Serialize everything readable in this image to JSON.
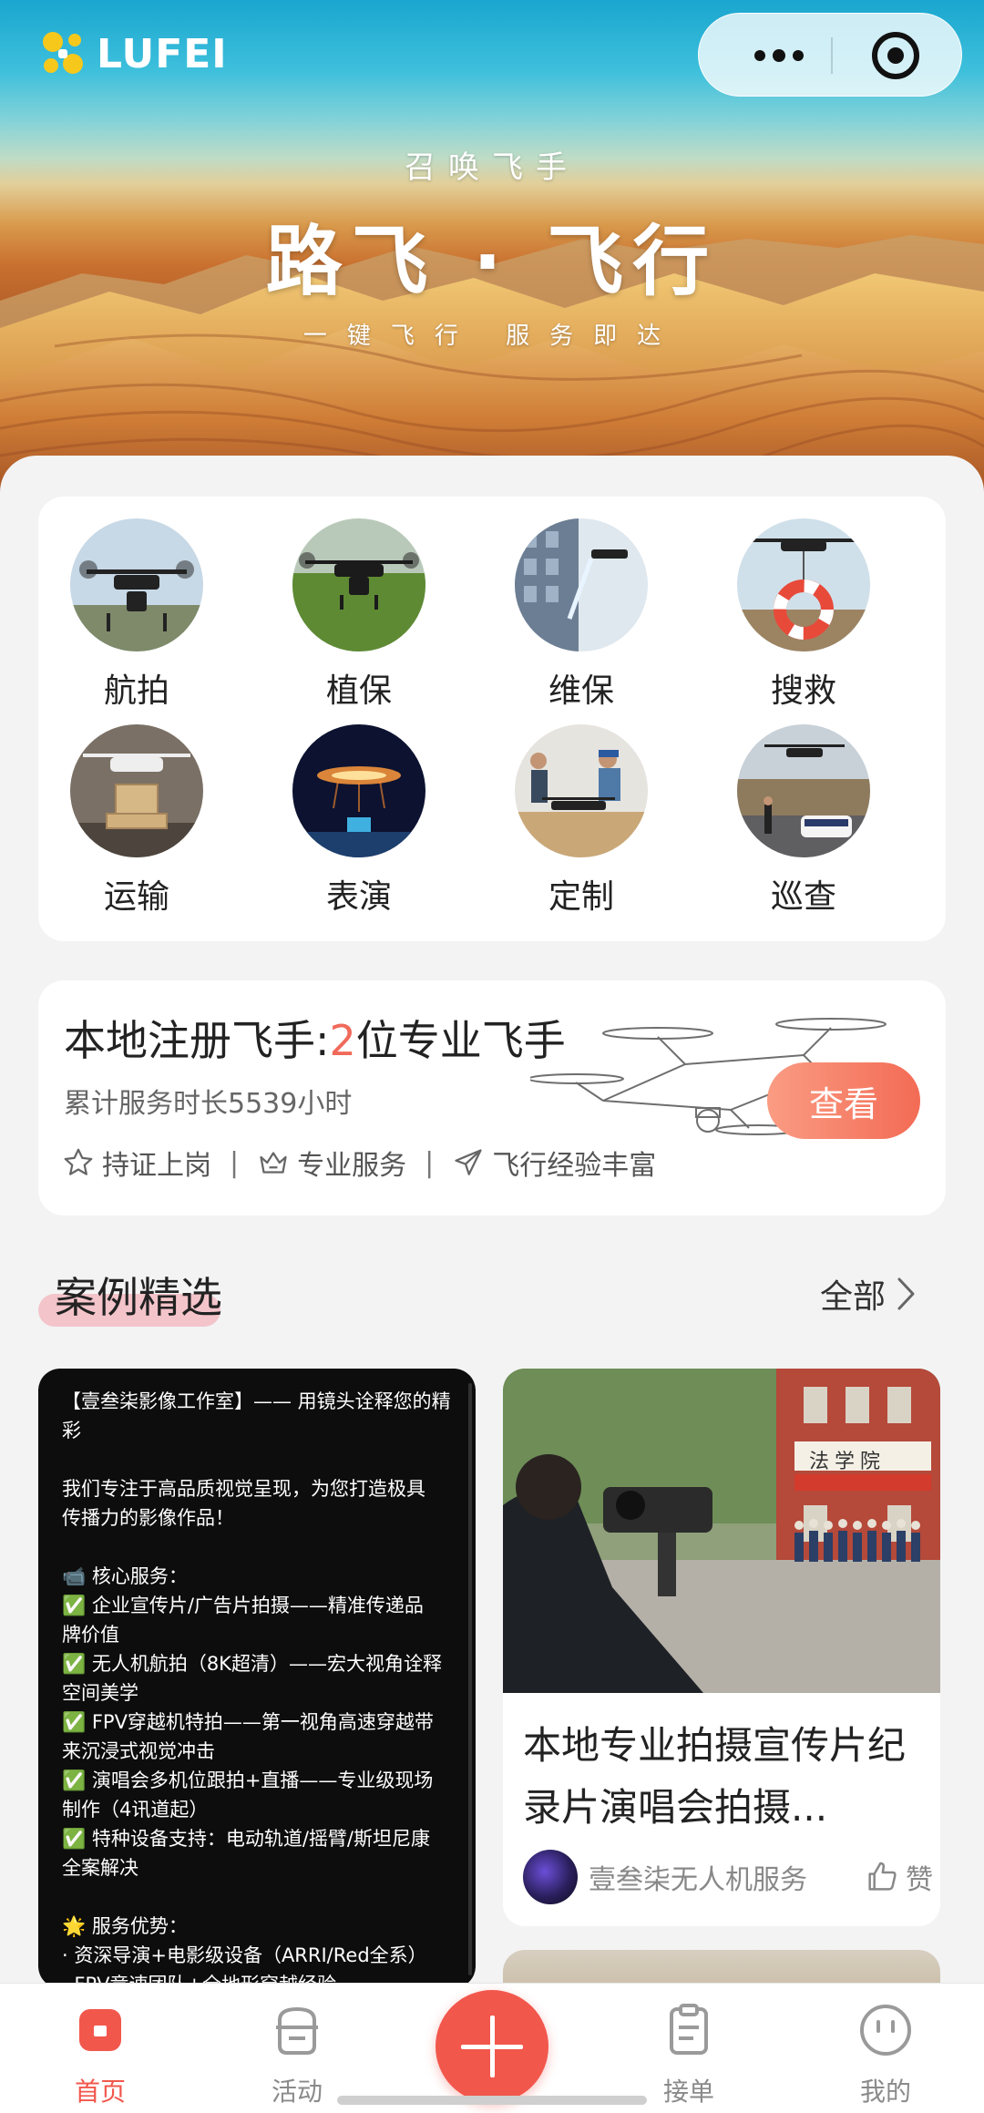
{
  "brand": {
    "logo_text": "LUFEI"
  },
  "hero": {
    "subtitle": "召唤飞手",
    "title": "路飞 · 飞行",
    "slogan": "一键飞行 服务即达"
  },
  "services": [
    {
      "label": "航拍",
      "icon": "aerial-drone-photo"
    },
    {
      "label": "植保",
      "icon": "crop-spraying-photo"
    },
    {
      "label": "维保",
      "icon": "building-cleaning-photo"
    },
    {
      "label": "搜救",
      "icon": "rescue-drone-photo"
    },
    {
      "label": "运输",
      "icon": "cargo-drone-photo"
    },
    {
      "label": "表演",
      "icon": "drone-show-photo"
    },
    {
      "label": "定制",
      "icon": "custom-build-photo"
    },
    {
      "label": "巡查",
      "icon": "patrol-drone-photo"
    }
  ],
  "pilots": {
    "prefix": "本地注册飞手:",
    "count": "2",
    "suffix": "位专业飞手",
    "hours": "累计服务时长5539小时",
    "view_button": "查看",
    "tags": [
      "持证上岗",
      "专业服务",
      "飞行经验丰富"
    ],
    "separator": "|"
  },
  "cases": {
    "section_title": "案例精选",
    "see_all": "全部",
    "left_card_lines": [
      "【壹叁柒影像工作室】—— 用镜头诠释您的精",
      "彩",
      "",
      "我们专注于高品质视觉呈现，为您打造极具",
      "传播力的影像作品！",
      "",
      "📹 核心服务：",
      "✅ 企业宣传片/广告片拍摄——精准传递品",
      "牌价值",
      "✅ 无人机航拍（8K超清）——宏大视角诠释",
      "空间美学",
      "✅ FPV穿越机特拍——第一视角高速穿越带",
      "来沉浸式视觉冲击",
      "✅ 演唱会多机位跟拍+直播——专业级现场",
      "制作（4讯道起）",
      "✅ 特种设备支持：电动轨道/摇臂/斯坦尼康",
      "全案解决",
      "",
      "🌟 服务优势：",
      "· 资深导演+电影级设备（ARRI/Red全系）",
      "· FPV竞速团队+全地形穿越经验"
    ],
    "right_card": {
      "title": "本地专业拍摄宣传片纪录片演唱会拍摄...",
      "author": "壹叁柒无人机服务",
      "like_label": "赞",
      "photo_sign": "法学院"
    }
  },
  "tabbar": {
    "home": "首页",
    "activity": "活动",
    "orders": "接单",
    "mine": "我的"
  },
  "colors": {
    "accent": "#f2574c",
    "highlight_num": "#f06a5a"
  }
}
